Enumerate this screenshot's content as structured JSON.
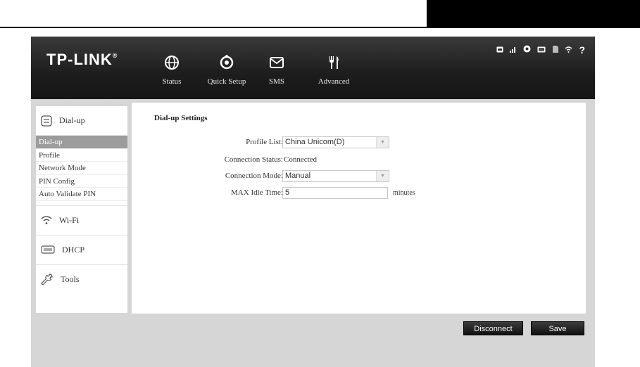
{
  "brand": {
    "logo": "TP-LINK",
    "mark": "®"
  },
  "nav": [
    {
      "label": "Status",
      "icon": "globe-icon"
    },
    {
      "label": "Quick Setup",
      "icon": "quick-setup-icon"
    },
    {
      "label": "SMS",
      "icon": "envelope-icon"
    },
    {
      "label": "Advanced",
      "icon": "tools-icon"
    }
  ],
  "status_bar": {
    "help": "?"
  },
  "sidebar": {
    "header": "Dial-up",
    "items": [
      {
        "label": "Dial-up",
        "active": true
      },
      {
        "label": "Profile"
      },
      {
        "label": "Network Mode"
      },
      {
        "label": "PIN Config"
      },
      {
        "label": "Auto Validate PIN"
      }
    ],
    "sections": [
      {
        "label": "Wi-Fi",
        "icon": "wifi-icon"
      },
      {
        "label": "DHCP",
        "icon": "dhcp-icon"
      },
      {
        "label": "Tools",
        "icon": "wrench-icon"
      }
    ]
  },
  "main": {
    "title": "Dial-up Settings",
    "profile_list": {
      "label": "Profile List:",
      "value": "China Unicom(D)"
    },
    "connection_status": {
      "label": "Connection Status:",
      "value": "Connected"
    },
    "connection_mode": {
      "label": "Connection Mode:",
      "value": "Manual"
    },
    "max_idle": {
      "label": "MAX Idle Time:",
      "value": "5",
      "unit": "minutes"
    }
  },
  "buttons": {
    "disconnect": "Disconnect",
    "save": "Save"
  },
  "colors": {
    "topbar": "#1d1d1d",
    "frame": "#d6d6d6",
    "active_item": "#9c9c9c"
  }
}
